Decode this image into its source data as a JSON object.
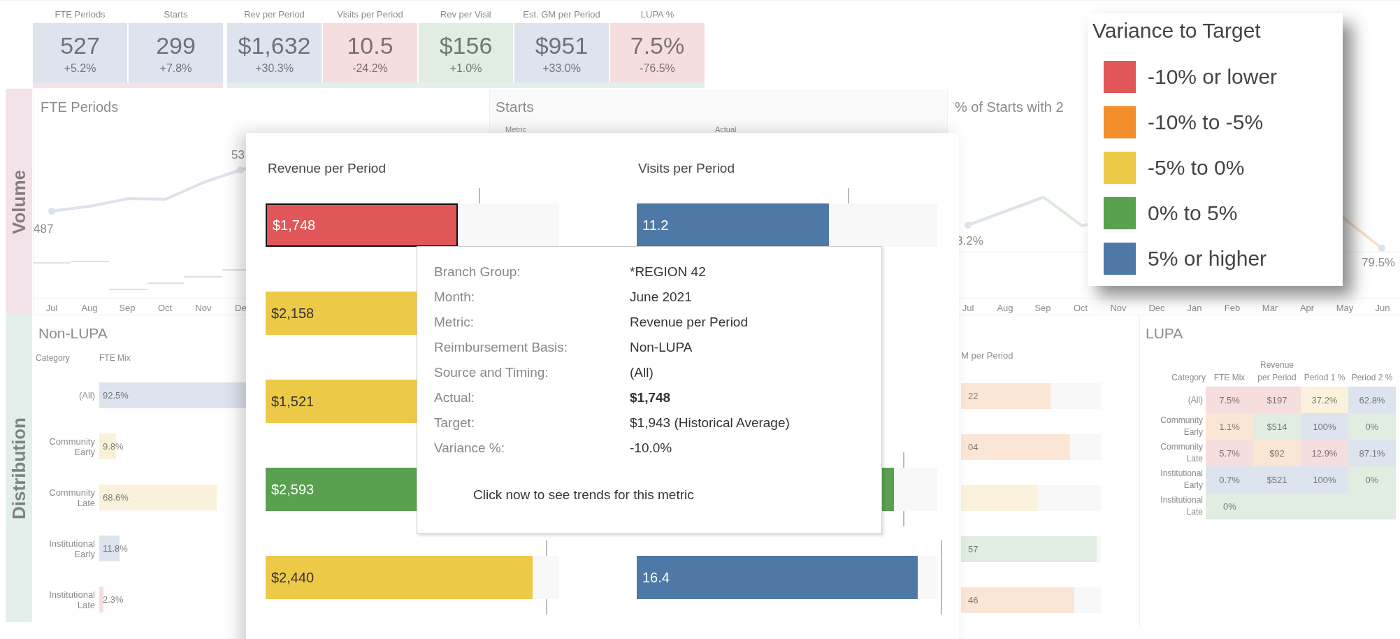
{
  "kpi_groups": [
    {
      "color": "#f3e4ea",
      "tiles": [
        {
          "label": "FTE Periods",
          "value": "527",
          "change": "+5.2%",
          "color": "#dde4ee"
        },
        {
          "label": "Starts",
          "value": "299",
          "change": "+7.8%",
          "color": "#dde4ee"
        }
      ]
    },
    {
      "color": "#e4f0ec",
      "tiles": [
        {
          "label": "Rev per Period",
          "value": "$1,632",
          "change": "+30.3%",
          "color": "#dde4ee"
        },
        {
          "label": "Visits per Period",
          "value": "10.5",
          "change": "-24.2%",
          "color": "#f6dede"
        },
        {
          "label": "Rev per Visit",
          "value": "$156",
          "change": "+1.0%",
          "color": "#e0ede0"
        },
        {
          "label": "Est. GM per Period",
          "value": "$951",
          "change": "+33.0%",
          "color": "#dde4ee"
        },
        {
          "label": "LUPA %",
          "value": "7.5%",
          "change": "-76.5%",
          "color": "#f6dede"
        }
      ]
    }
  ],
  "sections": [
    {
      "title": "Volume",
      "color": "#f1e3e9"
    },
    {
      "title": "Distribution",
      "color": "#e3efeb"
    }
  ],
  "volume_panels": [
    {
      "kind": "line",
      "title": "FTE Periods",
      "labels": [
        "487",
        "53"
      ],
      "months": [
        "Jul",
        "Aug",
        "Sep",
        "Oct",
        "Nov",
        "De"
      ]
    },
    {
      "kind": "table",
      "title": "Starts",
      "columns": [
        "Metric",
        "Actual"
      ]
    },
    {
      "kind": "line",
      "title": "% of Starts with 2",
      "labels": [
        "3.2%",
        "79.5%"
      ],
      "months": [
        "Jul",
        "Aug",
        "Sep",
        "Oct",
        "Nov",
        "Dec",
        "Jan",
        "Feb",
        "Mar",
        "Apr",
        "May",
        "Jun"
      ]
    }
  ],
  "non_lupa": {
    "title": "Non-LUPA",
    "columns": [
      "Category",
      "FTE Mix"
    ],
    "rows": [
      {
        "category": "(All)",
        "value": "92.5%",
        "level": 0.925,
        "color": "#dde4ee"
      },
      {
        "category": "Community Early",
        "value": "9.8%",
        "level": 0.098,
        "color": "#faf1d9"
      },
      {
        "category": "Community Late",
        "value": "68.6%",
        "level": 0.686,
        "color": "#faf1dc"
      },
      {
        "category": "Institutional Early",
        "value": "11.8%",
        "level": 0.118,
        "color": "#dde4ee"
      },
      {
        "category": "Institutional Late",
        "value": "2.3%",
        "level": 0.023,
        "color": "#f6dede"
      }
    ]
  },
  "gm": {
    "title": "M per Period",
    "bars": [
      {
        "label": "22",
        "level": 0.64,
        "color": "#fbe6d6"
      },
      {
        "label": "04",
        "level": 0.78,
        "color": "#fbe6d6"
      },
      {
        "level": 0.55,
        "color": "#faf2dc"
      },
      {
        "label": "57",
        "level": 0.97,
        "color": "#e0ede0"
      },
      {
        "label": "46",
        "level": 0.81,
        "color": "#fbe6d6"
      }
    ]
  },
  "lupa": {
    "title": "LUPA",
    "columns": [
      "Category",
      "FTE Mix",
      "Revenue per Period",
      "Period 1 %",
      "Period 2 %"
    ],
    "rows": [
      {
        "kind": "cells",
        "cells": [
          {
            "text": "(All)"
          },
          {
            "text": "7.5%",
            "color": "#f6dede"
          },
          {
            "text": "$197",
            "color": "#f6dede"
          },
          {
            "text": "37.2%",
            "color": "#faf2dc"
          },
          {
            "text": "62.8%",
            "color": "#dde4ee"
          }
        ]
      },
      {
        "kind": "cells",
        "cells": [
          {
            "text": "Community Early"
          },
          {
            "text": "1.1%",
            "color": "#fbe6d6"
          },
          {
            "text": "$514",
            "color": "#e0ede0"
          },
          {
            "text": "100%",
            "color": "#dde4ee"
          },
          {
            "text": "0%",
            "color": "#e0ede0"
          }
        ]
      },
      {
        "kind": "cells",
        "cells": [
          {
            "text": "Community Late"
          },
          {
            "text": "5.7%",
            "color": "#f6dede"
          },
          {
            "text": "$92",
            "color": "#fbe6d6"
          },
          {
            "text": "12.9%",
            "color": "#f6dede"
          },
          {
            "text": "87.1%",
            "color": "#dde4ee"
          }
        ]
      },
      {
        "kind": "cells",
        "cells": [
          {
            "text": "Institutional Early"
          },
          {
            "text": "0.7%",
            "color": "#dde4ee"
          },
          {
            "text": "$521",
            "color": "#dde4ee"
          },
          {
            "text": "100%",
            "color": "#dde4ee"
          },
          {
            "text": "0%",
            "color": "#e0ede0"
          }
        ]
      },
      {
        "kind": "merged",
        "cells": [
          {
            "text": "Institutional Late"
          },
          {
            "text": "0%",
            "color": "#e0ede0"
          }
        ]
      }
    ]
  },
  "popup": {
    "columns": [
      "Revenue per Period",
      "Visits per Period"
    ],
    "rows": [
      {
        "revenue": {
          "label": "$1,748",
          "level": 0.655,
          "color": "#e15759",
          "selected": true
        },
        "visits": {
          "label": "11.2",
          "level": 0.64,
          "color": "#4e79a7",
          "selected": false
        }
      },
      {
        "revenue": {
          "label": "$2,158",
          "level": 0.81,
          "color": "#edc948",
          "selected": false
        }
      },
      {
        "revenue": {
          "label": "$1,521",
          "level": 0.57,
          "color": "#edc948",
          "selected": false
        }
      },
      {
        "revenue": {
          "label": "$2,593",
          "level": 0.97,
          "color": "#59a14f",
          "selected": false
        },
        "visits": {
          "level": 0.855,
          "color": "#59a14f",
          "selected": false
        }
      },
      {
        "revenue": {
          "label": "$2,440",
          "level": 0.91,
          "color": "#edc948",
          "selected": false
        },
        "visits": {
          "label": "16.4",
          "level": 0.935,
          "color": "#4e79a7",
          "selected": false
        }
      }
    ]
  },
  "tooltip": {
    "rows": [
      {
        "label": "Branch Group:",
        "value": "*REGION 42",
        "bold": false
      },
      {
        "label": "Month:",
        "value": "June 2021",
        "bold": false
      },
      {
        "label": "Metric:",
        "value": "Revenue per Period",
        "bold": false
      },
      {
        "label": "Reimbursement Basis:",
        "value": "Non-LUPA",
        "bold": false
      },
      {
        "label": "Source and Timing:",
        "value": "(All)",
        "bold": false
      },
      {
        "label": "Actual:",
        "value": "$1,748",
        "bold": true
      },
      {
        "label": "Target:",
        "value": "$1,943 (Historical Average)",
        "bold": false
      },
      {
        "label": "Variance %:",
        "value": "-10.0%",
        "bold": false
      }
    ],
    "action": "Click now to see trends for this metric"
  },
  "legend": {
    "title": "Variance to Target",
    "items": [
      {
        "label": "-10% or lower",
        "color": "#e15759"
      },
      {
        "label": "-10% to -5%",
        "color": "#f28e2b"
      },
      {
        "label": "-5% to 0%",
        "color": "#edc948"
      },
      {
        "label": "0% to 5%",
        "color": "#59a14f"
      },
      {
        "label": "5% or higher",
        "color": "#4e79a7"
      }
    ]
  }
}
